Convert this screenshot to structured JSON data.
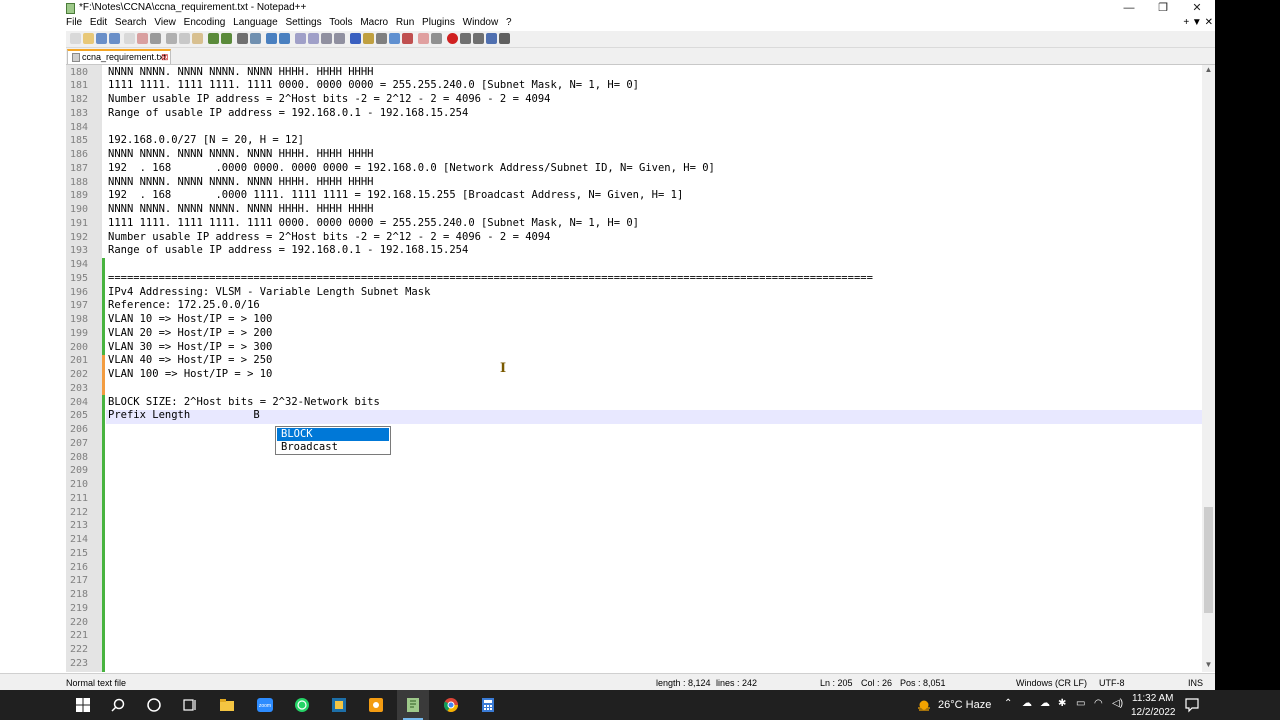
{
  "window": {
    "title": "*F:\\Notes\\CCNA\\ccna_requirement.txt - Notepad++",
    "minimize": "—",
    "maximize": "❐",
    "close": "✕"
  },
  "menu": {
    "items": [
      "File",
      "Edit",
      "Search",
      "View",
      "Encoding",
      "Language",
      "Settings",
      "Tools",
      "Macro",
      "Run",
      "Plugins",
      "Window",
      "?"
    ],
    "right": "+ ▼ ✕"
  },
  "tab": {
    "label": "ccna_requirement.txt",
    "close": "⊠"
  },
  "editor": {
    "lines": [
      {
        "n": "180",
        "t": "NNNN NNNN. NNNN NNNN. NNNN HHHH. HHHH HHHH"
      },
      {
        "n": "181",
        "t": "1111 1111. 1111 1111. 1111 0000. 0000 0000 = 255.255.240.0 [Subnet Mask, N= 1, H= 0]"
      },
      {
        "n": "182",
        "t": "Number usable IP address = 2^Host bits -2 = 2^12 - 2 = 4096 - 2 = 4094"
      },
      {
        "n": "183",
        "t": "Range of usable IP address = 192.168.0.1 - 192.168.15.254"
      },
      {
        "n": "184",
        "t": ""
      },
      {
        "n": "185",
        "t": "192.168.0.0/27 [N = 20, H = 12]"
      },
      {
        "n": "186",
        "t": "NNNN NNNN. NNNN NNNN. NNNN HHHH. HHHH HHHH"
      },
      {
        "n": "187",
        "t": "192  . 168       .0000 0000. 0000 0000 = 192.168.0.0 [Network Address/Subnet ID, N= Given, H= 0]"
      },
      {
        "n": "188",
        "t": "NNNN NNNN. NNNN NNNN. NNNN HHHH. HHHH HHHH"
      },
      {
        "n": "189",
        "t": "192  . 168       .0000 1111. 1111 1111 = 192.168.15.255 [Broadcast Address, N= Given, H= 1]"
      },
      {
        "n": "190",
        "t": "NNNN NNNN. NNNN NNNN. NNNN HHHH. HHHH HHHH"
      },
      {
        "n": "191",
        "t": "1111 1111. 1111 1111. 1111 0000. 0000 0000 = 255.255.240.0 [Subnet Mask, N= 1, H= 0]"
      },
      {
        "n": "192",
        "t": "Number usable IP address = 2^Host bits -2 = 2^12 - 2 = 4096 - 2 = 4094"
      },
      {
        "n": "193",
        "t": "Range of usable IP address = 192.168.0.1 - 192.168.15.254"
      },
      {
        "n": "194",
        "t": ""
      },
      {
        "n": "195",
        "t": "========================================================================================================================="
      },
      {
        "n": "196",
        "t": "IPv4 Addressing: VLSM - Variable Length Subnet Mask"
      },
      {
        "n": "197",
        "t": "Reference: 172.25.0.0/16"
      },
      {
        "n": "198",
        "t": "VLAN 10 => Host/IP = > 100"
      },
      {
        "n": "199",
        "t": "VLAN 20 => Host/IP = > 200"
      },
      {
        "n": "200",
        "t": "VLAN 30 => Host/IP = > 300"
      },
      {
        "n": "201",
        "t": "VLAN 40 => Host/IP = > 250"
      },
      {
        "n": "202",
        "t": "VLAN 100 => Host/IP = > 10"
      },
      {
        "n": "203",
        "t": ""
      },
      {
        "n": "204",
        "t": "BLOCK SIZE: 2^Host bits = 2^32-Network bits"
      },
      {
        "n": "205",
        "t": "Prefix Length          B"
      },
      {
        "n": "206",
        "t": ""
      },
      {
        "n": "207",
        "t": ""
      },
      {
        "n": "208",
        "t": ""
      },
      {
        "n": "209",
        "t": ""
      },
      {
        "n": "210",
        "t": ""
      },
      {
        "n": "211",
        "t": ""
      },
      {
        "n": "212",
        "t": ""
      },
      {
        "n": "213",
        "t": ""
      },
      {
        "n": "214",
        "t": ""
      },
      {
        "n": "215",
        "t": ""
      },
      {
        "n": "216",
        "t": ""
      },
      {
        "n": "217",
        "t": ""
      },
      {
        "n": "218",
        "t": ""
      },
      {
        "n": "219",
        "t": ""
      },
      {
        "n": "220",
        "t": ""
      },
      {
        "n": "221",
        "t": ""
      },
      {
        "n": "222",
        "t": ""
      },
      {
        "n": "223",
        "t": ""
      }
    ],
    "autocomplete": [
      "BLOCK",
      "Broadcast"
    ]
  },
  "status": {
    "file_type": "Normal text file",
    "length": "length : 8,124",
    "lines": "lines : 242",
    "ln": "Ln : 205",
    "col": "Col : 26",
    "pos": "Pos : 8,051",
    "eol": "Windows (CR LF)",
    "encoding": "UTF-8",
    "mode": "INS"
  },
  "taskbar": {
    "weather": "26°C  Haze",
    "time": "11:32 AM",
    "date": "12/2/2022",
    "icons": [
      "windows-start-icon",
      "search-icon",
      "cortana-icon",
      "task-view-icon",
      "file-explorer-icon",
      "zoom-icon",
      "whatsapp-icon",
      "app-icon",
      "app-icon-2",
      "notepadpp-icon",
      "chrome-icon",
      "calculator-icon"
    ]
  },
  "colors": {
    "accent": "#0078d7",
    "changed_green": "#48b33f",
    "changed_orange": "#f39c40",
    "current_line": "#e8e8ff"
  }
}
